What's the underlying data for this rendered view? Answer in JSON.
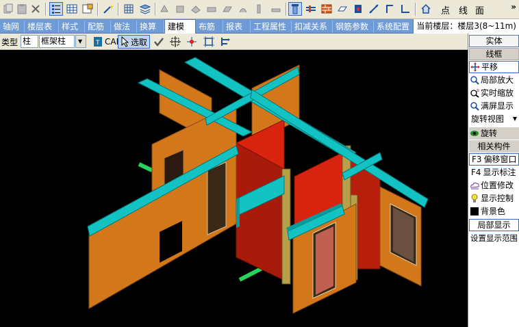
{
  "toolbar": {
    "label_point": "点",
    "label_line": "线",
    "label_face": "面",
    "more": "»"
  },
  "tabs": [
    {
      "label": "轴网"
    },
    {
      "label": "楼层表"
    },
    {
      "label": "样式"
    },
    {
      "label": "配筋"
    },
    {
      "label": "做法"
    },
    {
      "label": "换算"
    },
    {
      "label": "建模"
    },
    {
      "label": "布筋"
    },
    {
      "label": "报表"
    },
    {
      "label": "工程属性"
    },
    {
      "label": "扣减关系"
    },
    {
      "label": "钢筋参数"
    },
    {
      "label": "系统配置"
    }
  ],
  "active_tab": "建模",
  "current_floor": "当前楼层：楼层3(8~11m)",
  "controls": {
    "type_label": "类型",
    "type_value": "柱",
    "subtype_value": "框架柱",
    "cad_label": "CAD",
    "select_label": "选取"
  },
  "panel": {
    "solid": "实体",
    "wireframe": "线框",
    "pan": "平移",
    "zoom_local": "局部放大",
    "zoom_realtime": "实时缩放",
    "zoom_extents": "满屏显示",
    "rotate_view": "旋转视图",
    "rotate": "旋转",
    "related": "相关构件",
    "offset_window": "偏移窗口",
    "show_label": "显示标注",
    "position_edit": "位置修改",
    "display_control": "显示控制",
    "background": "背景色",
    "local_display": "局部显示",
    "set_display_range": "设置显示范围",
    "key_f3": "F3",
    "key_f4": "F4"
  },
  "colors": {
    "wall_orange": "#d2771a",
    "beam_cyan": "#13c2c2",
    "wall_red": "#d8230f",
    "column_tan": "#b8a04a",
    "rebar_green": "#27d35a",
    "tab_bar": "#6f9bd6"
  }
}
